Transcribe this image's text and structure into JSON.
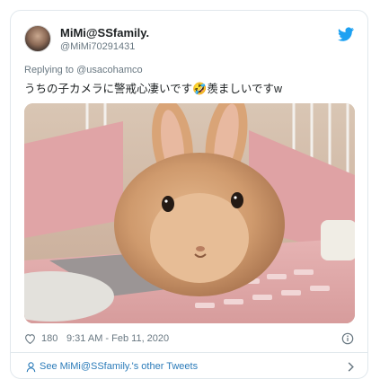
{
  "tweet": {
    "display_name": "MiMi@SSfamily.",
    "handle": "@MiMi70291431",
    "reply_prefix": "Replying to",
    "reply_to": "@usacohamco",
    "text_part1": "うちの子カメラに警戒心凄いです",
    "emoji": "🤣",
    "text_part2": "羨ましいですw",
    "likes": "180",
    "timestamp": "9:31 AM - Feb 11, 2020",
    "footer_link": "See MiMi@SSfamily.'s other Tweets"
  },
  "icons": {
    "brand": "twitter-bird-icon",
    "like": "heart-icon",
    "info": "info-icon",
    "profile": "person-icon",
    "more": "chevron-right-icon"
  },
  "colors": {
    "brand_blue": "#1da1f2",
    "link_blue": "#2b7bb9",
    "muted_text": "#697882",
    "border": "#e1e8ed"
  }
}
